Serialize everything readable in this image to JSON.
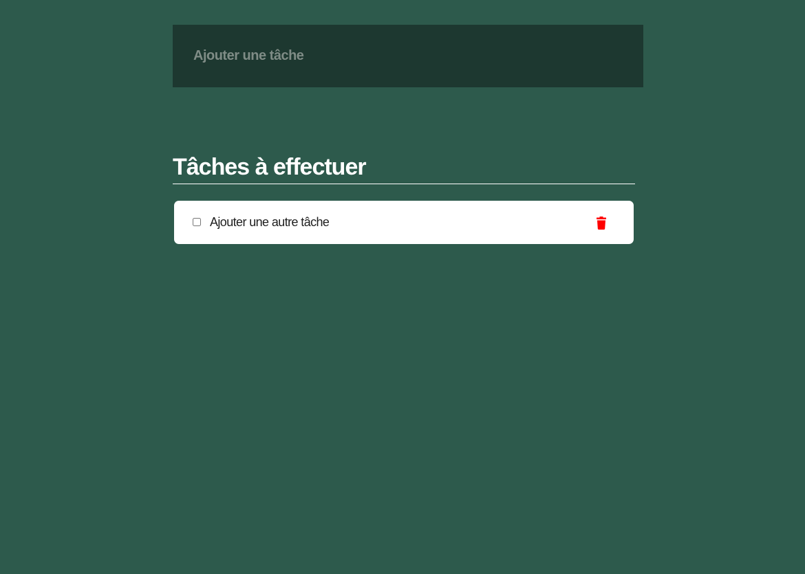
{
  "new_task": {
    "placeholder": "Ajouter une tâche",
    "value": ""
  },
  "todo_section": {
    "title": "Tâches à effectuer"
  },
  "tasks": [
    {
      "label": "Ajouter une autre tâche",
      "checked": false,
      "delete_icon": "trash-icon"
    }
  ],
  "colors": {
    "background": "#2d5a4c",
    "input_background": "#1d3830",
    "delete_accent": "#ff0000"
  }
}
